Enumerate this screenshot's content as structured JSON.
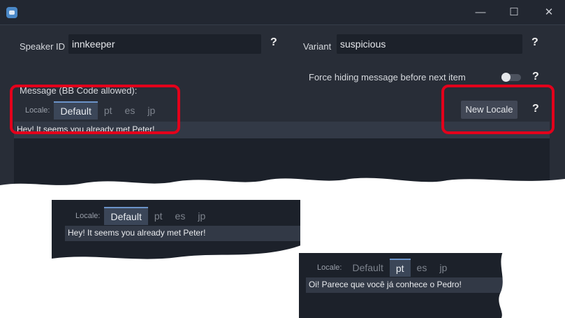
{
  "form": {
    "speaker_label": "Speaker ID",
    "speaker_value": "innkeeper",
    "variant_label": "Variant",
    "variant_value": "suspicious",
    "help_glyph": "?",
    "force_hide_label": "Force hiding message before next item",
    "message_label": "Message (BB Code allowed):",
    "locale_label": "Locale:",
    "tabs": [
      "Default",
      "pt",
      "es",
      "jp"
    ],
    "new_locale_button": "New Locale",
    "message_text": "Hey! It seems you already met Peter!"
  },
  "window": {
    "minimize": "—",
    "maximize": "☐",
    "close": "✕"
  },
  "crop1": {
    "locale_label": "Locale:",
    "tabs": [
      "Default",
      "pt",
      "es",
      "jp"
    ],
    "text": "Hey! It seems you already met Peter!"
  },
  "crop2": {
    "locale_label": "Locale:",
    "tabs": [
      "Default",
      "pt",
      "es",
      "jp"
    ],
    "text": "Oi! Parece que você já conhece o Pedro!"
  },
  "colors": {
    "highlight": "#e3001b",
    "active_tab": "#3b4658",
    "accent": "#6b93c9"
  },
  "icons": [
    "godot-app-icon",
    "minimize-icon",
    "maximize-icon",
    "close-icon",
    "toggle-switch"
  ]
}
